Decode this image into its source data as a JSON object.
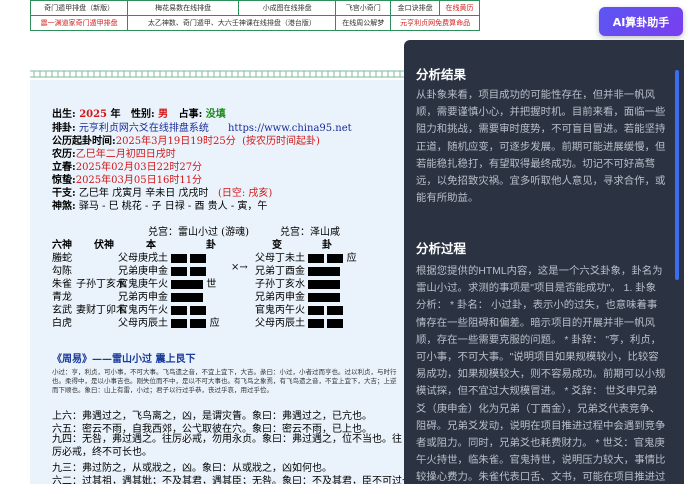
{
  "topnav": {
    "row1": [
      "奇门遁甲排盘（新版）",
      "梅花易数在线排盘",
      "小成图在线排盘",
      "飞宫小奇门",
      "金口诀排盘",
      "在线黄历"
    ],
    "row2": [
      "震一渊道家奇门遁甲排盘",
      "太乙神数、奇门遁甲、大六壬神课在线排盘（港台版）",
      "在线周公解梦",
      "元亨利贞网免费算命品"
    ]
  },
  "info": {
    "l1": {
      "k1": "出生:",
      "v1": "2025",
      "y": " 年",
      "k2": "性别:",
      "v2": "男",
      "k3": "占事:",
      "v3": "没填"
    },
    "l2": {
      "k": "排卦:",
      "v": "元亨利贞网六爻在线排盘系统",
      "url": "https://www.china95.net"
    },
    "l3": {
      "k": "公历起卦时间:",
      "v": "2025年3月19日19时25分",
      "note": "(按农历时间起卦)"
    },
    "l4": {
      "k": "农历:",
      "v": "乙巳年二月初四日戌时"
    },
    "l5": {
      "k": "立春:",
      "v": "2025年02月03日22时27分"
    },
    "l6": {
      "k": "惊蛰:",
      "v": "2025年03月05日16时11分"
    },
    "l7": {
      "k": "干支:",
      "v": "乙巳年  戊寅月  辛未日  戊戌时",
      "kong": "(日空: 戌亥)"
    },
    "l8": {
      "k": "神煞:",
      "v": "驿马 - 巳   桃花 - 子   日禄 - 酉   贵人 - 寅，午"
    }
  },
  "gua": {
    "main_title": "兑宫：雷山小过 (游魂)",
    "change_title": "兑宫：泽山咸",
    "headers": [
      "六神",
      "伏神",
      "本",
      "卦",
      "变",
      "卦"
    ],
    "rows": [
      {
        "shen": "螣蛇",
        "fu": "",
        "ben": "父母庚戌土",
        "mark": "",
        "bian": "父母丁未土",
        "bm": "应"
      },
      {
        "shen": "勾陈",
        "fu": "",
        "ben": "兄弟庚申金",
        "mark": "×→",
        "bian": "兄弟丁酉金",
        "bm": ""
      },
      {
        "shen": "朱雀",
        "fu": "子孙丁亥水",
        "ben": "官鬼庚午火",
        "mark": "世",
        "bian": "子孙丁亥水",
        "bm": ""
      },
      {
        "shen": "青龙",
        "fu": "",
        "ben": "兄弟丙申金",
        "mark": "",
        "bian": "兄弟丙申金",
        "bm": ""
      },
      {
        "shen": "玄武",
        "fu": "妻财丁卯木",
        "ben": "官鬼丙午火",
        "mark": "",
        "bian": "官鬼丙午火",
        "bm": ""
      },
      {
        "shen": "白虎",
        "fu": "",
        "ben": "父母丙辰土",
        "mark": "应",
        "bian": "父母丙辰土",
        "bm": ""
      }
    ]
  },
  "zhouyi": {
    "title": "《周易》——雷山小过 震上艮下",
    "desc": "小过：亨，利贞，可小事，不可大事。飞鸟遗之音，不宜上宜下，大吉。彖曰：小过，小者过而亨也。过以利贞，与时行也。柔得中，是以小事吉也。刚失位而不中，是以不可大事也。有飞鸟之象焉，有飞鸟遗之音，不宜上宜下，大吉；上逆而下顺也。象曰：山上有雷，小过；君子以行过乎恭，丧过乎哀，用过乎俭。",
    "lines": [
      "上六：弗遇过之，飞鸟离之，凶，是谓灾眚。象曰：弗遇过之，已亢也。",
      "六五：密云不雨，自我西郊，公弋取彼在穴。象曰：密云不雨，已上也。",
      "九四：无咎，弗过遇之。往厉必戒，勿用永贞。象曰：弗过遇之，位不当也。往厉必戒，终不可长也。",
      "九三：弗过防之，从或戕之，凶。象曰：从或戕之，凶如何也。",
      "六二：过其祖，遇其妣；不及其君，遇其臣；无咎。象曰：不及其君，臣不可过也。"
    ]
  },
  "ai_button": "AI算卦助手",
  "panel": {
    "h1": "分析结果",
    "p1": "从卦象来看，项目成功的可能性存在，但并非一帆风顺，需要谨慎小心，并把握时机。目前来看，面临一些阻力和挑战，需要审时度势，不可盲目冒进。若能坚持正道，随机应变，可逐步发展。前期可能进展缓慢，但若能稳扎稳打，有望取得最终成功。切记不可好高骛远，以免招致灾祸。宜多听取他人意见，寻求合作，或能有所助益。",
    "h2": "分析过程",
    "p2": "根据您提供的HTML内容，这是一个六爻卦象，卦名为雷山小过。求测的事项是\"项目是否能成功\"。 1. 卦象分析： * 卦名： 小过卦，表示小的过失，也意味着事情存在一些阻碍和偏差。暗示项目的开展并非一帆风顺，存在一些需要克服的问题。 * 卦辞： \"亨，利贞，可小事，不可大事。\"说明项目如果规模较小，比较容易成功，如果规模较大，则不容易成功。前期可以小规模试探，但不宜过大规模冒进。 * 爻辞： 世爻申兄弟爻（庚申金）化为兄弟（丁酉金），兄弟爻代表竞争、阻碍。兄弟爻发动，说明在项目推进过程中会遇到竞争者或阻力。同时，兄弟爻也耗费财力。 * 世爻：官鬼庚午火持世，临朱雀。官鬼持世，说明压力较大，事情比较操心费力。朱雀代表口舌、文书，可能在项目推进过程中会有一些文书上的问题"
  },
  "colors": {
    "accent": "#6a4cf0",
    "panel_bg": "#2b3342",
    "article_bg": "#eaf3fb",
    "nav_border": "#2f8f5a"
  }
}
